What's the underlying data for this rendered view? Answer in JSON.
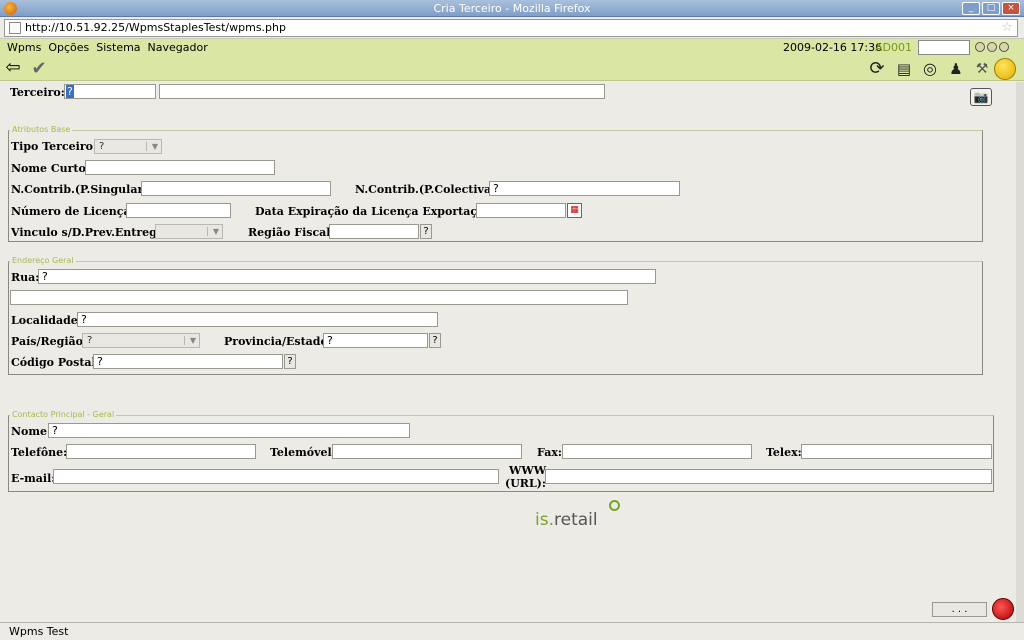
{
  "window": {
    "title": "Cria Terceiro - Mozilla Firefox"
  },
  "browser": {
    "url": "http://10.51.92.25/WpmsStaplesTest/wpms.php"
  },
  "menu": {
    "items": [
      "Wpms",
      "Opções",
      "Sistema",
      "Navegador"
    ],
    "datetime": "2009-02-16 17:36",
    "user": "AD001"
  },
  "toolbar": {
    "left_icons": [
      "back-arrow-icon",
      "checkmark-icon"
    ],
    "right_icons": [
      "refresh-icon",
      "print-icon",
      "lifebuoy-icon",
      "stamp-icon",
      "tool-icon",
      "status-light-icon"
    ]
  },
  "top": {
    "terceiro_label": "Terceiro:",
    "terceiro_value": "?",
    "terceiro_name": ""
  },
  "atributos": {
    "legend": "Atributos Base",
    "tipo_label": "Tipo Terceiro:",
    "tipo_value": "?",
    "nome_curto_label": "Nome Curto:",
    "ncontrib_singular_label": "N.Contrib.(P.Singular):",
    "ncontrib_colectiva_label": "N.Contrib.(P.Colectiva):",
    "ncontrib_colectiva_value": "?",
    "licenca_label": "Número de Licença:",
    "data_exp_label": "Data Expiração da Licença Exportação:",
    "vinculo_label": "Vinculo s/D.Prev.Entrega:",
    "regiao_label": "Região Fiscal:",
    "q": "?"
  },
  "endereco": {
    "legend": "Endereço Geral",
    "rua_label": "Rua:",
    "rua_value": "?",
    "localidade_label": "Localidade:",
    "localidade_value": "?",
    "pais_label": "País/Região:",
    "pais_value": "?",
    "provincia_label": "Provincia/Estado:",
    "provincia_value": "?",
    "postal_label": "Código Postal:",
    "postal_value": "?",
    "q": "?"
  },
  "contacto": {
    "legend": "Contacto Principal - Geral",
    "nome_label": "Nome:",
    "nome_value": "?",
    "telefone_label": "Telefône:",
    "telemovel_label": "Telemóvel:",
    "fax_label": "Fax:",
    "telex_label": "Telex:",
    "email_label": "E-mail:",
    "www_label": "WWW",
    "url_label": "(URL):"
  },
  "logo": {
    "pre": "is",
    "dot": ".",
    "post": "retail"
  },
  "footer": {
    "dots_label": ". . .",
    "status": "Wpms Test"
  }
}
